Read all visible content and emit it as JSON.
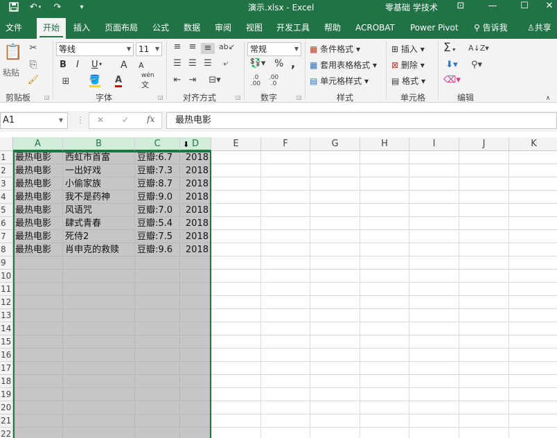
{
  "titlebar": {
    "save_icon": "save-icon",
    "undo_icon": "undo-icon",
    "redo_icon": "redo-icon",
    "customize_icon": "customize-icon",
    "title": "演示.xlsx  -  Excel",
    "account": "零基础 学技术",
    "colors": {
      "background": "#217346",
      "text": "#ffffff"
    }
  },
  "tabs": [
    {
      "label": "文件"
    },
    {
      "label": "开始"
    },
    {
      "label": "插入"
    },
    {
      "label": "页面布局"
    },
    {
      "label": "公式"
    },
    {
      "label": "数据"
    },
    {
      "label": "审阅"
    },
    {
      "label": "视图"
    },
    {
      "label": "开发工具"
    },
    {
      "label": "帮助"
    },
    {
      "label": "ACROBAT"
    },
    {
      "label": "Power Pivot"
    },
    {
      "label": "告诉我"
    },
    {
      "label": "共享"
    }
  ],
  "ribbon": {
    "clipboard": {
      "paste": "粘贴",
      "label": "剪贴板"
    },
    "font": {
      "name": "等线",
      "size": "11",
      "bold": "B",
      "italic": "I",
      "underline": "U",
      "grow": "A",
      "shrink": "A",
      "wen": "wén",
      "wen2": "文",
      "label": "字体"
    },
    "align": {
      "label": "对齐方式"
    },
    "number": {
      "format": "常规",
      "percent": "%",
      "comma": ",",
      "label": "数字"
    },
    "styles": {
      "conditional": "条件格式",
      "table": "套用表格格式",
      "cell": "单元格样式",
      "label": "样式"
    },
    "cells": {
      "insert": "插入",
      "delete": "删除",
      "format": "格式",
      "label": "单元格"
    },
    "editing": {
      "sum": "Σ",
      "label": "编辑"
    }
  },
  "formula_bar": {
    "name_box": "A1",
    "cancel": "✕",
    "enter": "✓",
    "fx": "fx",
    "content": "最热电影"
  },
  "grid": {
    "columns": [
      "A",
      "B",
      "C",
      "D",
      "E",
      "F",
      "G",
      "H",
      "I",
      "J",
      "K"
    ],
    "selected_columns": [
      "A",
      "B",
      "C",
      "D"
    ],
    "rows": [
      "1",
      "2",
      "3",
      "4",
      "5",
      "6",
      "7",
      "8",
      "9",
      "10",
      "11",
      "12",
      "13",
      "14",
      "15",
      "16",
      "17",
      "18",
      "19",
      "20",
      "21",
      "22"
    ],
    "data": [
      [
        "最热电影",
        "西虹市首富",
        "豆瓣:6.7",
        "2018"
      ],
      [
        "最热电影",
        "一出好戏",
        "豆瓣:7.3",
        "2018"
      ],
      [
        "最热电影",
        "小偷家族",
        "豆瓣:8.7",
        "2018"
      ],
      [
        "最热电影",
        "我不是药神",
        "豆瓣:9.0",
        "2018"
      ],
      [
        "最热电影",
        "风语咒",
        "豆瓣:7.0",
        "2018"
      ],
      [
        "最热电影",
        "肆式青春",
        "豆瓣:5.4",
        "2018"
      ],
      [
        "最热电影",
        "死侍2",
        "豆瓣:7.5",
        "2018"
      ],
      [
        "最热电影",
        "肖申克的救赎",
        "豆瓣:9.6",
        "2018"
      ]
    ],
    "colors": {
      "selection": "#c6c6c6",
      "selection_border": "#217346",
      "header_selected": "#d2ecdb"
    }
  }
}
